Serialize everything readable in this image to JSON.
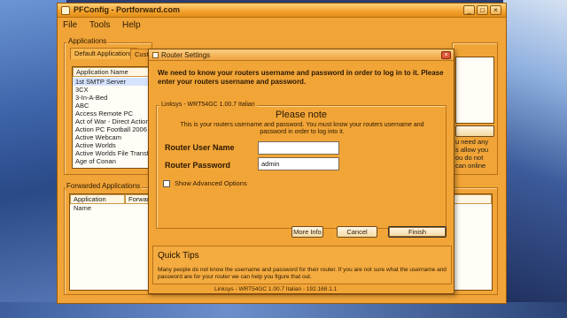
{
  "window": {
    "title": "PFConfig - Portforward.com"
  },
  "menu": [
    "File",
    "Tools",
    "Help"
  ],
  "applications": {
    "group_label": "Applications",
    "tabs": [
      "Default Applications",
      "Cust"
    ],
    "list_header": "Application Name",
    "items": [
      "1st SMTP Server",
      "3CX",
      "3-In-A-Bed",
      "ABC",
      "Access Remote PC",
      "Act of War - Direct Action",
      "Action PC Football 2006",
      "Active Webcam",
      "Active Worlds",
      "Active Worlds File Transfer",
      "Age of Conan"
    ]
  },
  "forwarded": {
    "group_label": "Forwarded Applications",
    "columns": [
      "Application Name",
      "Forwar"
    ]
  },
  "background_note": [
    "u need any",
    "s allow you",
    "ou do not",
    "can online"
  ],
  "dialog": {
    "title": "Router Settings",
    "intro": "We need to know your routers username and password in order to log in to it. Please enter your routers username and password.",
    "router_model": "Linksys - WRT54GC 1.00.7 Italian",
    "note_heading": "Please note",
    "note_text": "This is your routers username and password. You must know your routers username and password in order to log into it.",
    "username_label": "Router User Name",
    "username_value": "",
    "password_label": "Router Password",
    "password_value": "admin",
    "show_advanced_label": "Show Advanced Options",
    "buttons": {
      "more_info": "More Info",
      "cancel": "Cancel",
      "finish": "Finish"
    },
    "tips_title": "Quick Tips",
    "tips_text": "Many people do not know the username and password for their router. If you are not sure what the username and password are for your router we can help you figure that out.",
    "status": "Linksys - WRT54GC 1.00.7 Italian - 192.168.1.1"
  }
}
